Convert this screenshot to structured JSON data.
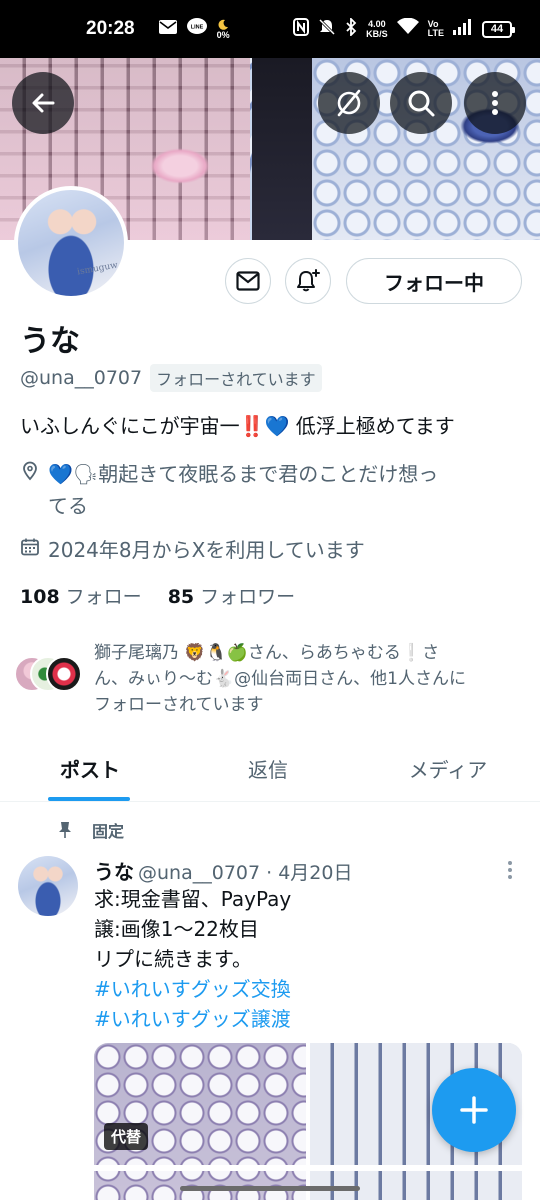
{
  "status_bar": {
    "time": "20:28",
    "battery_pct": "0%",
    "net_speed_value": "4.00",
    "net_speed_unit": "KB/S",
    "volte_top": "Vo",
    "volte_bottom": "LTE",
    "battery": "44",
    "icons_left": [
      "mail-icon",
      "line-icon",
      "moon-icon"
    ],
    "icons_right": [
      "nfc-icon",
      "mute-icon",
      "bluetooth-icon",
      "wifi-icon",
      "signal-icon"
    ]
  },
  "header_buttons": [
    "back-arrow-icon",
    "grok-icon",
    "search-icon",
    "more-vertical-icon"
  ],
  "profile": {
    "name": "うな",
    "handle": "@una__0707",
    "follows_you": "フォローされています",
    "bio": "いふしんぐにこが宇宙一‼️💙 低浮上極めてます",
    "location_line1": "💙🗣朝起きて夜眠るまで君のことだけ想っ",
    "location_line2": "てる",
    "joined": "2024年8月からXを利用しています",
    "avatar_tag": "ismuguw",
    "following_count": "108",
    "following_label": "フォロー",
    "followers_count": "85",
    "followers_label": "フォロワー",
    "follow_button": "フォロー中",
    "mutuals_line1": "獅子尾璃乃 🦁🐧🍏さん、らあちゃむる❕さ",
    "mutuals_line2": "ん、みぃり〜む🐇@仙台両日さん、他1人さんに",
    "mutuals_line3": "フォローされています"
  },
  "tabs": [
    {
      "label": "ポスト",
      "active": true
    },
    {
      "label": "返信",
      "active": false
    },
    {
      "label": "メディア",
      "active": false
    }
  ],
  "post": {
    "pinned_label": "固定",
    "author": "うな",
    "handle_date": "@una__0707 · 4月20日",
    "line1": "求:現金書留、PayPay",
    "line2": "譲:画像1〜22枚目",
    "line3": "リプに続きます。",
    "hashtag1": "#いれいすグッズ交換",
    "hashtag2": "#いれいすグッズ譲渡",
    "alt_badge": "代替"
  },
  "colors": {
    "accent": "#1d9bf0",
    "text": "#0f1419",
    "muted": "#536471"
  }
}
